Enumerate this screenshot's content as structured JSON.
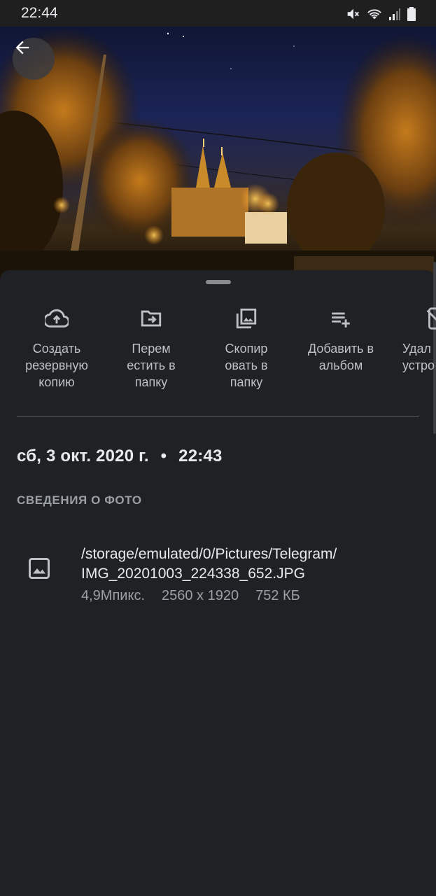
{
  "status_bar": {
    "time": "22:44",
    "icons": [
      "mute-icon",
      "wifi-icon",
      "signal-icon",
      "battery-icon"
    ]
  },
  "photo": {
    "back_icon": "arrow-left-icon"
  },
  "actions": [
    {
      "label": "Создать\nрезервную\nкопию",
      "icon": "cloud-upload-icon"
    },
    {
      "label": "Перем\nестить в\nпапку",
      "icon": "move-to-folder-icon"
    },
    {
      "label": "Скопир\nовать в\nпапку",
      "icon": "copy-to-folder-icon"
    },
    {
      "label": "Добавить в\nальбом",
      "icon": "add-to-playlist-icon"
    },
    {
      "label": "Удал\nустро",
      "icon": "delete-from-device-icon"
    }
  ],
  "details": {
    "date": "сб, 3 окт. 2020 г.",
    "separator": "•",
    "time": "22:43",
    "section_title": "СВЕДЕНИЯ О ФОТО",
    "file": {
      "path": "/storage/emulated/0/Pictures/Telegram/\nIMG_20201003_224338_652.JPG",
      "megapixels": "4,9Мпикс.",
      "resolution": "2560 x 1920",
      "size": "752 КБ",
      "icon": "image-icon"
    }
  },
  "colors": {
    "background": "#202124",
    "text_primary": "#e8eaed",
    "text_secondary": "#9aa0a6"
  }
}
